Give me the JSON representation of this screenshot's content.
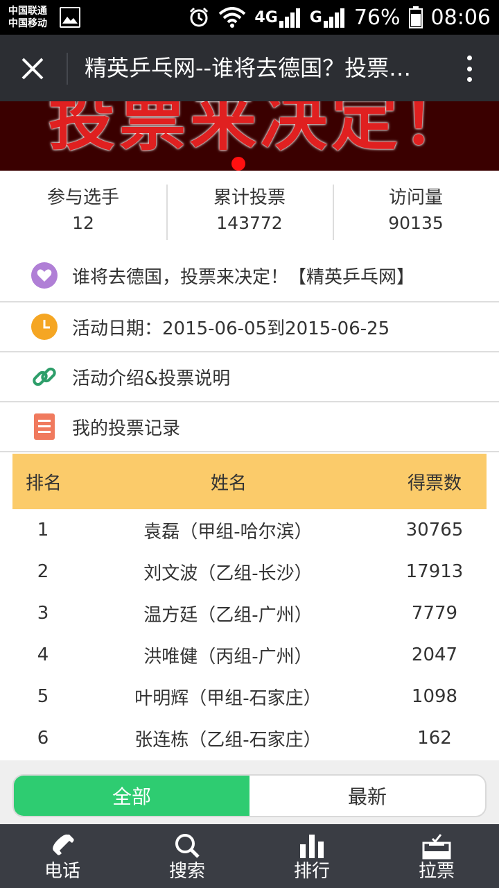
{
  "status_bar": {
    "carrier_1": "中国联通",
    "carrier_2": "中国移动",
    "network_1": "4G",
    "network_2": "G",
    "battery": "76%",
    "time": "08:06"
  },
  "appbar": {
    "title": "精英乒乓网--谁将去德国？投票来决定！"
  },
  "banner": {
    "text": "投票来决定！"
  },
  "stats": [
    {
      "label": "参与选手",
      "value": "12"
    },
    {
      "label": "累计投票",
      "value": "143772"
    },
    {
      "label": "访问量",
      "value": "90135"
    }
  ],
  "info_rows": [
    {
      "icon": "heart-icon",
      "text": "谁将去德国，投票来决定！【精英乒乓网】"
    },
    {
      "icon": "clock-icon",
      "text": "活动日期：2015-06-05到2015-06-25"
    },
    {
      "icon": "link-icon",
      "text": "活动介绍&投票说明"
    },
    {
      "icon": "list-icon",
      "text": "我的投票记录"
    }
  ],
  "table": {
    "headers": {
      "rank": "排名",
      "name": "姓名",
      "votes": "得票数"
    },
    "rows": [
      {
        "rank": "1",
        "name": "袁磊（甲组-哈尔滨）",
        "votes": "30765"
      },
      {
        "rank": "2",
        "name": "刘文波（乙组-长沙）",
        "votes": "17913"
      },
      {
        "rank": "3",
        "name": "温方廷（乙组-广州）",
        "votes": "7779"
      },
      {
        "rank": "4",
        "name": "洪唯健（丙组-广州）",
        "votes": "2047"
      },
      {
        "rank": "5",
        "name": "叶明辉（甲组-石家庄）",
        "votes": "1098"
      },
      {
        "rank": "6",
        "name": "张连栋（乙组-石家庄）",
        "votes": "162"
      }
    ]
  },
  "filter": {
    "all": "全部",
    "latest": "最新"
  },
  "bottom_nav": [
    {
      "icon": "phone-icon",
      "label": "电话"
    },
    {
      "icon": "search-icon",
      "label": "搜索"
    },
    {
      "icon": "bar-chart-icon",
      "label": "排行"
    },
    {
      "icon": "ballot-box-icon",
      "label": "拉票"
    }
  ],
  "colors": {
    "header_bg": "#2c2e33",
    "table_header_bg": "#fbcb6a",
    "active_tab": "#2ecc71",
    "nav_bg": "#3a3d44",
    "heart": "#b07fd6",
    "clock": "#f5a623",
    "link": "#2e9e6a",
    "list": "#f07a5e"
  }
}
